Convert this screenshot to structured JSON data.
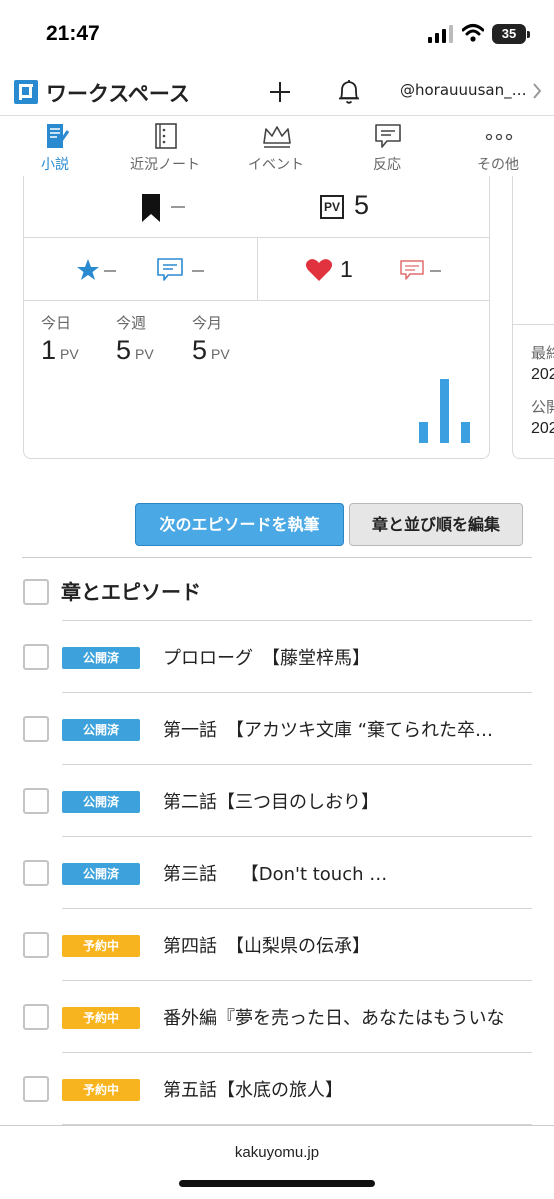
{
  "status": {
    "time": "21:47",
    "battery": "35"
  },
  "header": {
    "title": "ワークスペース",
    "username": "@horauuusan_…",
    "icons": [
      "logo-icon",
      "plus-icon",
      "bell-icon",
      "chevron-right-icon"
    ]
  },
  "tabs": [
    {
      "label": "小説",
      "icon": "novel-icon",
      "active": true
    },
    {
      "label": "近況ノート",
      "icon": "notebook-icon",
      "active": false
    },
    {
      "label": "イベント",
      "icon": "crown-icon",
      "active": false
    },
    {
      "label": "反応",
      "icon": "chat-icon",
      "active": false
    },
    {
      "label": "その他",
      "icon": "more-icon",
      "active": false
    }
  ],
  "stats": {
    "bookmarks": "",
    "pv_total": "5",
    "pv_badge": "PV",
    "stars": "",
    "comments": "",
    "hearts": "1",
    "reviews": "",
    "periods": [
      {
        "label": "今日",
        "value": "1",
        "unit": "PV"
      },
      {
        "label": "今週",
        "value": "5",
        "unit": "PV"
      },
      {
        "label": "今月",
        "value": "5",
        "unit": "PV"
      }
    ],
    "mini_chart": {
      "values": [
        1,
        3,
        1
      ],
      "max": 3
    },
    "colors": {
      "accent": "#2a8ad0",
      "bar": "#3b9fe0",
      "heart": "#e0333f",
      "review": "#e26b6b"
    }
  },
  "side_card": {
    "label1": "最終",
    "value1": "202",
    "label2": "公開",
    "value2": "202"
  },
  "actions": {
    "next_episode": "次のエピソードを執筆",
    "edit_order": "章と並び順を編集"
  },
  "section": {
    "title": "章とエピソード"
  },
  "episodes": [
    {
      "status": "公開済",
      "type": "published",
      "title": "プロローグ　【藤堂梓馬】"
    },
    {
      "status": "公開済",
      "type": "published",
      "title": "第一話　【アカツキ文庫 “棄てられた卒…"
    },
    {
      "status": "公開済",
      "type": "published",
      "title": "第二話【三つ目のしおり】"
    },
    {
      "status": "公開済",
      "type": "published",
      "title": "第三話　 【Don't touch …"
    },
    {
      "status": "予約中",
      "type": "scheduled",
      "title": "第四話　【山梨県の伝承】"
    },
    {
      "status": "予約中",
      "type": "scheduled",
      "title": "番外編『夢を売った日、あなたはもういな"
    },
    {
      "status": "予約中",
      "type": "scheduled",
      "title": "第五話【水底の旅人】"
    }
  ],
  "footer": {
    "domain": "kakuyomu.jp"
  }
}
